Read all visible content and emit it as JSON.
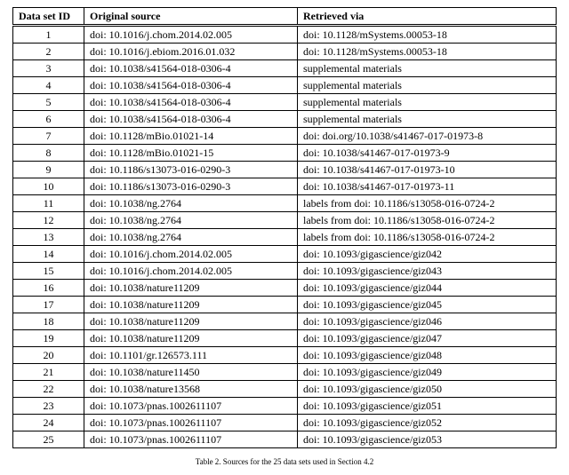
{
  "table": {
    "headers": {
      "id": "Data set ID",
      "original": "Original source",
      "retrieved": "Retrieved via"
    },
    "rows": [
      {
        "id": "1",
        "original": "doi: 10.1016/j.chom.2014.02.005",
        "retrieved": "doi: 10.1128/mSystems.00053-18"
      },
      {
        "id": "2",
        "original": "doi: 10.1016/j.ebiom.2016.01.032",
        "retrieved": "doi: 10.1128/mSystems.00053-18"
      },
      {
        "id": "3",
        "original": "doi: 10.1038/s41564-018-0306-4",
        "retrieved": "supplemental materials"
      },
      {
        "id": "4",
        "original": "doi: 10.1038/s41564-018-0306-4",
        "retrieved": "supplemental materials"
      },
      {
        "id": "5",
        "original": "doi: 10.1038/s41564-018-0306-4",
        "retrieved": "supplemental materials"
      },
      {
        "id": "6",
        "original": "doi: 10.1038/s41564-018-0306-4",
        "retrieved": "supplemental materials"
      },
      {
        "id": "7",
        "original": "doi: 10.1128/mBio.01021-14",
        "retrieved": "doi: doi.org/10.1038/s41467-017-01973-8"
      },
      {
        "id": "8",
        "original": "doi: 10.1128/mBio.01021-15",
        "retrieved": "doi: 10.1038/s41467-017-01973-9"
      },
      {
        "id": "9",
        "original": "doi: 10.1186/s13073-016-0290-3",
        "retrieved": "doi: 10.1038/s41467-017-01973-10"
      },
      {
        "id": "10",
        "original": "doi: 10.1186/s13073-016-0290-3",
        "retrieved": "doi: 10.1038/s41467-017-01973-11"
      },
      {
        "id": "11",
        "original": "doi: 10.1038/ng.2764",
        "retrieved": "labels from doi: 10.1186/s13058-016-0724-2"
      },
      {
        "id": "12",
        "original": "doi: 10.1038/ng.2764",
        "retrieved": "labels from doi: 10.1186/s13058-016-0724-2"
      },
      {
        "id": "13",
        "original": "doi: 10.1038/ng.2764",
        "retrieved": "labels from doi: 10.1186/s13058-016-0724-2"
      },
      {
        "id": "14",
        "original": "doi: 10.1016/j.chom.2014.02.005",
        "retrieved": "doi: 10.1093/gigascience/giz042"
      },
      {
        "id": "15",
        "original": "doi: 10.1016/j.chom.2014.02.005",
        "retrieved": "doi: 10.1093/gigascience/giz043"
      },
      {
        "id": "16",
        "original": "doi: 10.1038/nature11209",
        "retrieved": "doi: 10.1093/gigascience/giz044"
      },
      {
        "id": "17",
        "original": "doi: 10.1038/nature11209",
        "retrieved": "doi: 10.1093/gigascience/giz045"
      },
      {
        "id": "18",
        "original": "doi: 10.1038/nature11209",
        "retrieved": "doi: 10.1093/gigascience/giz046"
      },
      {
        "id": "19",
        "original": "doi: 10.1038/nature11209",
        "retrieved": "doi: 10.1093/gigascience/giz047"
      },
      {
        "id": "20",
        "original": "doi: 10.1101/gr.126573.111",
        "retrieved": "doi: 10.1093/gigascience/giz048"
      },
      {
        "id": "21",
        "original": "doi: 10.1038/nature11450",
        "retrieved": "doi: 10.1093/gigascience/giz049"
      },
      {
        "id": "22",
        "original": "doi: 10.1038/nature13568",
        "retrieved": "doi: 10.1093/gigascience/giz050"
      },
      {
        "id": "23",
        "original": "doi: 10.1073/pnas.1002611107",
        "retrieved": "doi: 10.1093/gigascience/giz051"
      },
      {
        "id": "24",
        "original": "doi: 10.1073/pnas.1002611107",
        "retrieved": "doi: 10.1093/gigascience/giz052"
      },
      {
        "id": "25",
        "original": "doi: 10.1073/pnas.1002611107",
        "retrieved": "doi: 10.1093/gigascience/giz053"
      }
    ]
  },
  "caption": "Table 2. Sources for the 25 data sets used in Section 4.2"
}
